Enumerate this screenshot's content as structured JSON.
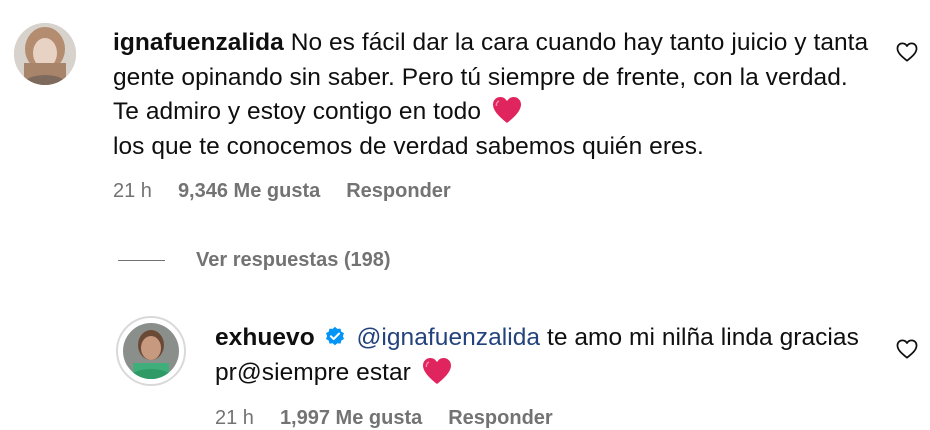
{
  "comment1": {
    "username": "ignafuenzalida",
    "text": "No es fácil dar la cara cuando hay tanto juicio y tanta gente opinando sin saber. Pero tú siempre de frente, con la verdad. Te admiro y estoy contigo en todo",
    "text_after_emoji": "los que te conocemos de verdad sabemos quién eres.",
    "time": "21 h",
    "likes": "9,346 Me gusta",
    "reply_label": "Responder"
  },
  "view_replies": {
    "label": "Ver respuestas (198)"
  },
  "comment2": {
    "username": "exhuevo",
    "mention": "@ignafuenzalida",
    "text": "te amo mi nilña linda gracias pr@siempre estar",
    "time": "21 h",
    "likes": "1,997 Me gusta",
    "reply_label": "Responder"
  },
  "colors": {
    "mention": "#24437c",
    "meta": "#737373",
    "verified": "#0095f6",
    "heart": "#e0245e"
  }
}
